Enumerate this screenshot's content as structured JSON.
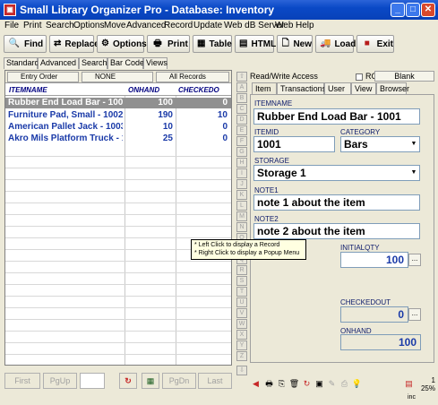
{
  "window": {
    "title": "Small Library Organizer Pro - Database: Inventory",
    "minimize": "_",
    "maximize": "□",
    "close": "✕"
  },
  "menu": [
    "File",
    "Print",
    "Search",
    "Options",
    "Move",
    "Advanced",
    "Record",
    "Update",
    "Web dB Server",
    "Web",
    "Help"
  ],
  "toolbar": {
    "find": "Find",
    "replace": "Replace",
    "options": "Options",
    "print": "Print",
    "table": "Table",
    "html": "HTML",
    "new": "New",
    "load": "Load",
    "exit": "Exit"
  },
  "view_tabs": [
    "Standard",
    "Advanced",
    "Search",
    "Bar Code",
    "Views"
  ],
  "order_bar": {
    "entry_order": "Entry Order",
    "none": "NONE",
    "all_records": "All Records"
  },
  "grid": {
    "columns": [
      "ITEMNAME",
      "ONHAND",
      "CHECKEDO"
    ],
    "rows": [
      {
        "name": "Rubber End Load Bar - 1001",
        "onhand": "100",
        "checked": "0"
      },
      {
        "name": "Furniture Pad, Small - 1002",
        "onhand": "190",
        "checked": "10"
      },
      {
        "name": "American Pallet Jack - 1003",
        "onhand": "10",
        "checked": "0"
      },
      {
        "name": "Akro Mils Platform Truck - 100",
        "onhand": "25",
        "checked": "0"
      }
    ]
  },
  "nav": {
    "first": "First",
    "pgup": "PgUp",
    "pgdn": "PgDn",
    "last": "Last"
  },
  "alpha": [
    "A",
    "B",
    "C",
    "D",
    "E",
    "F",
    "G",
    "H",
    "I",
    "J",
    "K",
    "L",
    "M",
    "N",
    "O",
    "P",
    "Q",
    "R",
    "S",
    "T",
    "U",
    "V",
    "W",
    "X",
    "Y",
    "Z"
  ],
  "access": "Read/Write Access",
  "ro_label": "RO",
  "blank_label": "Blank",
  "record_tabs": [
    "Item",
    "Transactions",
    "User",
    "View",
    "Browser"
  ],
  "form": {
    "itemname_label": "ITEMNAME",
    "itemname": "Rubber End Load Bar - 1001",
    "itemid_label": "ITEMID",
    "itemid": "1001",
    "category_label": "CATEGORY",
    "category": "Bars",
    "storage_label": "STORAGE",
    "storage": "Storage 1",
    "note1_label": "NOTE1",
    "note1": "note 1 about the item",
    "note2_label": "NOTE2",
    "note2": "note 2 about the item",
    "initialqty_label": "INITIALQTY",
    "initialqty": "100",
    "checkedout_label": "CHECKEDOUT",
    "checkedout": "0",
    "onhand_label": "ONHAND",
    "onhand": "100",
    "dots": "..."
  },
  "tooltip": {
    "line1": "* Left Click to display a Record",
    "line2": "* Right Click to display a Popup Menu"
  },
  "status": {
    "record": "1",
    "zoom": "25%",
    "footer": "inc"
  }
}
